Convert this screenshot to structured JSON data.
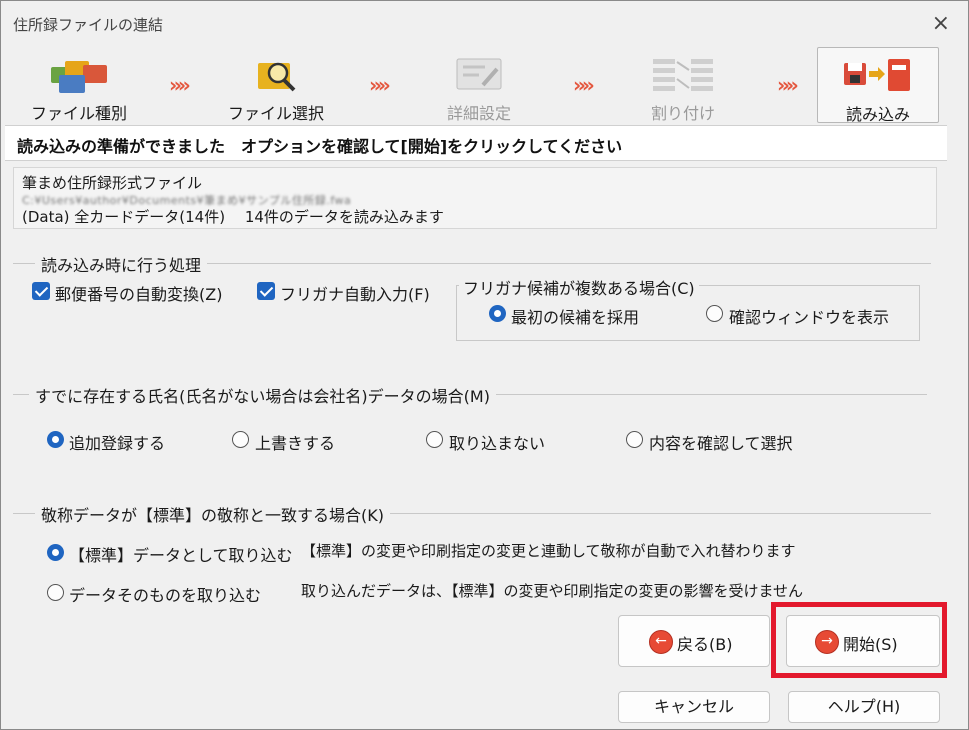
{
  "window": {
    "title": "住所録ファイルの連結",
    "close_icon": "×"
  },
  "wizard": {
    "steps": [
      {
        "label": "ファイル種別",
        "icon": "folders-icon",
        "state": "done"
      },
      {
        "label": "ファイル選択",
        "icon": "folder-search-icon",
        "state": "done"
      },
      {
        "label": "詳細設定",
        "icon": "settings-tools-icon",
        "state": "disabled"
      },
      {
        "label": "割り付け",
        "icon": "mapping-icon",
        "state": "disabled"
      },
      {
        "label": "読み込み",
        "icon": "import-book-icon",
        "state": "current"
      }
    ],
    "arrow": "»»"
  },
  "banner": "読み込みの準備ができました　オプションを確認して[開始]をクリックしてください",
  "file_info": {
    "format": "筆まめ住所録形式ファイル",
    "path": "C:¥Users¥author¥Documents¥筆まめ¥サンプル住所録.fwa",
    "summary": "(Data) 全カードデータ(14件)　 14件のデータを読み込みます"
  },
  "section1": {
    "title": "読み込み時に行う処理",
    "postal": {
      "label": "郵便番号の自動変換(Z)",
      "checked": true
    },
    "furigana": {
      "label": "フリガナ自動入力(F)",
      "checked": true
    },
    "furigana_group": {
      "title": "フリガナ候補が複数ある場合(C)",
      "options": [
        {
          "label": "最初の候補を採用",
          "selected": true
        },
        {
          "label": "確認ウィンドウを表示",
          "selected": false
        }
      ]
    }
  },
  "section2": {
    "title": "すでに存在する氏名(氏名がない場合は会社名)データの場合(M)",
    "options": [
      {
        "label": "追加登録する",
        "selected": true
      },
      {
        "label": "上書きする",
        "selected": false
      },
      {
        "label": "取り込まない",
        "selected": false
      },
      {
        "label": "内容を確認して選択",
        "selected": false
      }
    ]
  },
  "section3": {
    "title": "敬称データが【標準】の敬称と一致する場合(K)",
    "options": [
      {
        "label": "【標準】データとして取り込む",
        "selected": true,
        "desc": "【標準】の変更や印刷指定の変更と連動して敬称が自動で入れ替わります"
      },
      {
        "label": "データそのものを取り込む",
        "selected": false,
        "desc": "取り込んだデータは、【標準】の変更や印刷指定の変更の影響を受けません"
      }
    ]
  },
  "buttons": {
    "back": "戻る(B)",
    "start": "開始(S)",
    "cancel": "キャンセル",
    "help": "ヘルプ(H)"
  },
  "colors": {
    "accent": "#1f65c1",
    "highlight": "#e3192d",
    "arrow": "#e4573f"
  }
}
